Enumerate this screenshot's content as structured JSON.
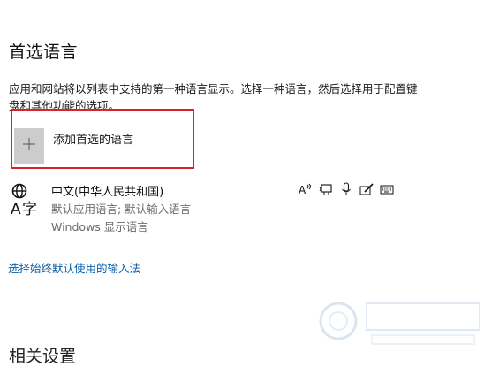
{
  "section": {
    "title": "首选语言",
    "description": "应用和网站将以列表中支持的第一种语言显示。选择一种语言，然后选择用于配置键盘和其他功能的选项。"
  },
  "add_language": {
    "label": "添加首选的语言",
    "icon": "plus-icon"
  },
  "language_item": {
    "name": "中文(中华人民共和国)",
    "subtitle1": "默认应用语言; 默认输入语言",
    "subtitle2": "Windows 显示语言",
    "feature_icons": [
      "text-to-speech-icon",
      "speech-recognition-icon",
      "microphone-icon",
      "handwriting-icon",
      "keyboard-icon"
    ]
  },
  "links": {
    "input_method": "选择始终默认使用的输入法"
  },
  "next_section": {
    "title": "相关设置"
  },
  "colors": {
    "highlight": "#d8232a",
    "link": "#0a5ea8"
  }
}
